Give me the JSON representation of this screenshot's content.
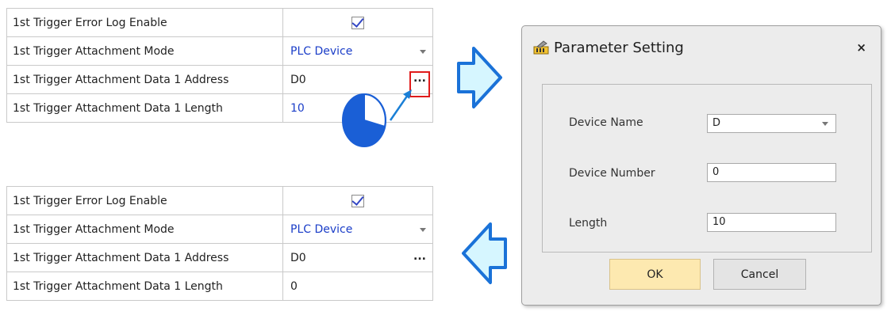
{
  "top_table": {
    "rows": [
      {
        "label": "1st Trigger Error Log Enable",
        "value": ""
      },
      {
        "label": "1st Trigger Attachment Mode",
        "value": "PLC Device"
      },
      {
        "label": "1st Trigger Attachment Data 1 Address",
        "value": "D0",
        "button": "..."
      },
      {
        "label": "1st Trigger Attachment Data 1 Length",
        "value": "10"
      }
    ]
  },
  "bottom_table": {
    "rows": [
      {
        "label": "1st Trigger Error Log Enable",
        "value": ""
      },
      {
        "label": "1st Trigger Attachment Mode",
        "value": "PLC Device"
      },
      {
        "label": "1st Trigger Attachment Data 1 Address",
        "value": "D0",
        "button": "..."
      },
      {
        "label": "1st Trigger Attachment Data 1 Length",
        "value": "0"
      }
    ]
  },
  "dialog": {
    "title": "Parameter Setting",
    "close": "×",
    "fields": [
      {
        "label": "Device Name",
        "value": "D"
      },
      {
        "label": "Device Number",
        "value": "0"
      },
      {
        "label": "Length",
        "value": "10"
      }
    ],
    "ok_label": "OK",
    "cancel_label": "Cancel"
  },
  "colors": {
    "value_blue": "#1a3dc8",
    "highlight_red": "#e01b1b",
    "arrow_fill": "#d6f6ff",
    "arrow_stroke": "#1a72d8",
    "ok_button": "#fde9b0"
  }
}
